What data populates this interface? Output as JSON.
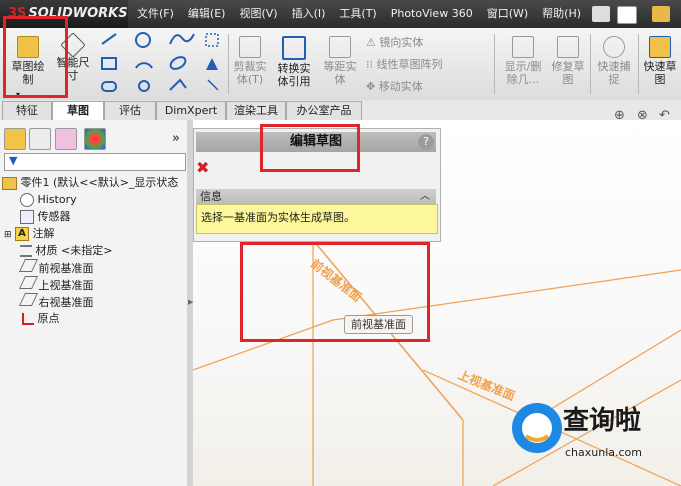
{
  "app": {
    "brand": "SOLIDWORKS",
    "brand_mark": "3S"
  },
  "menubar": {
    "items": [
      "文件(F)",
      "编辑(E)",
      "视图(V)",
      "插入(I)",
      "工具(T)",
      "PhotoView 360",
      "窗口(W)",
      "帮助(H)"
    ]
  },
  "toolbar": {
    "sketch_line1": "草图绘",
    "sketch_line2": "制",
    "smart_dim_line1": "智能尺",
    "smart_dim_line2": "寸",
    "trim_line1": "剪裁实",
    "trim_line2": "体(T)",
    "convert_line1": "转换实",
    "convert_line2": "体引用",
    "offset_line1": "等距实",
    "offset_line2": "体",
    "mirror": "镜向实体",
    "linear_pattern": "线性草图阵列",
    "move": "移动实体",
    "display_line1": "显示/删",
    "display_line2": "除几...",
    "repair_line1": "修复草",
    "repair_line2": "图",
    "snap_line1": "快速捕",
    "snap_line2": "捉",
    "quick_line1": "快速草",
    "quick_line2": "图"
  },
  "tabs": [
    "特征",
    "草图",
    "评估",
    "DimXpert",
    "渲染工具",
    "办公室产品"
  ],
  "active_tab": "草图",
  "tree": {
    "root": "零件1 (默认<<默认>_显示状态",
    "items": [
      "History",
      "传感器",
      "注解",
      "材质 <未指定>",
      "前视基准面",
      "上视基准面",
      "右视基准面",
      "原点"
    ]
  },
  "property_manager": {
    "title": "编辑草图",
    "help": "?",
    "info_header": "信息",
    "info_text": "选择一基准面为实体生成草图。"
  },
  "viewport": {
    "front_plane_label": "前视基准面",
    "front_plane_tag": "前视基准面",
    "top_plane_label": "上视基准面"
  },
  "watermark": {
    "brand": "查询啦",
    "url": "chaxunla.com"
  },
  "colors": {
    "accent_red": "#e0252a",
    "plane_orange": "#f0a050",
    "info_yellow": "#fbf79a",
    "watermark_blue": "#1e88e5"
  }
}
